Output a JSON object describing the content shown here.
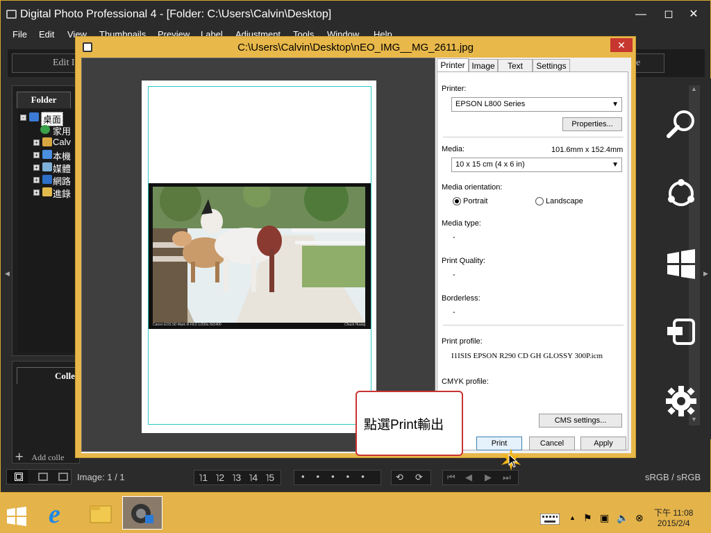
{
  "app": {
    "title": "Digital Photo Professional 4 - [Folder: C:\\Users\\Calvin\\Desktop]",
    "menu": [
      "File",
      "Edit",
      "View",
      "Thumbnails",
      "Preview",
      "Label",
      "Adjustment",
      "Tools",
      "Window",
      "Help"
    ],
    "toolbar": {
      "edit_label": "Edit I",
      "right_label": "e"
    },
    "folder_tab": "Folder",
    "tree": [
      {
        "label": "桌面",
        "selected": true
      },
      {
        "label": "家用"
      },
      {
        "label": "Calv"
      },
      {
        "label": "本機"
      },
      {
        "label": "媒體"
      },
      {
        "label": "網路"
      },
      {
        "label": "進錄"
      }
    ],
    "collection_tab": "Colle",
    "add_collection": "Add colle",
    "status": {
      "image_count": "Image: 1 / 1",
      "ratings": [
        "˥1",
        "˥2",
        "˥3",
        "˥4",
        "˥5"
      ],
      "color_space": "sRGB / sRGB"
    }
  },
  "dialog": {
    "title": "C:\\Users\\Calvin\\Desktop\\nEO_IMG__MG_2611.jpg",
    "close": "✕",
    "tabs": [
      "Printer",
      "Image",
      "Text",
      "Settings"
    ],
    "active_tab": "Printer",
    "printer_label": "Printer:",
    "printer_value": "EPSON L800 Series",
    "properties_button": "Properties...",
    "media_label": "Media:",
    "media_size": "101.6mm x 152.4mm",
    "media_value": "10 x 15 cm (4 x 6 in)",
    "orientation_label": "Media orientation:",
    "portrait": "Portrait",
    "landscape": "Landscape",
    "media_type_label": "Media type:",
    "media_type_value": "-",
    "print_quality_label": "Print Quality:",
    "print_quality_value": "-",
    "borderless_label": "Borderless:",
    "borderless_value": "-",
    "print_profile_label": "Print profile:",
    "print_profile_value": "I1ISIS EPSON R290 CD GH GLOSSY 300P.icm",
    "cmyk_label": "CMYK profile:",
    "cms_button": "CMS settings...",
    "print_button": "Print",
    "cancel_button": "Cancel",
    "apply_button": "Apply",
    "photo_caption_left": "Canon EOS 5D Mark III F8.0 1/200s ISO400",
    "photo_caption_right": "Chuck Huang"
  },
  "callout": {
    "text": "點選Print輸出"
  },
  "taskbar": {
    "time": "下午 11:08",
    "date": "2015/2/4"
  }
}
